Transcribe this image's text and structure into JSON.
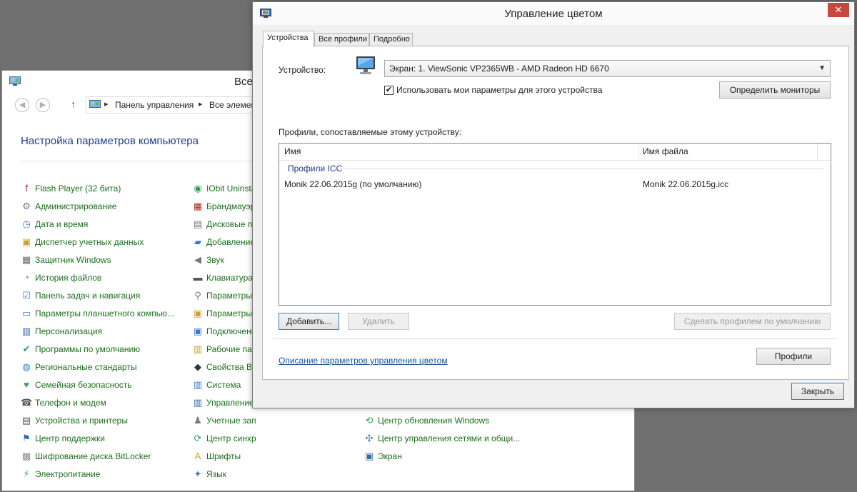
{
  "control_panel": {
    "title": "Все",
    "breadcrumb": [
      "Панель управления",
      "Все элемен"
    ],
    "heading": "Настройка параметров компьютера",
    "col1": [
      {
        "label": "Flash Player (32 бита)",
        "icon": "flash-icon"
      },
      {
        "label": "Администрирование",
        "icon": "admin-tools-icon"
      },
      {
        "label": "Дата и время",
        "icon": "clock-icon"
      },
      {
        "label": "Диспетчер учетных данных",
        "icon": "credential-manager-icon"
      },
      {
        "label": "Защитник Windows",
        "icon": "defender-icon"
      },
      {
        "label": "История файлов",
        "icon": "file-history-icon"
      },
      {
        "label": "Панель задач и навигация",
        "icon": "taskbar-icon"
      },
      {
        "label": "Параметры планшетного компью...",
        "icon": "tablet-icon"
      },
      {
        "label": "Персонализация",
        "icon": "personalization-icon"
      },
      {
        "label": "Программы по умолчанию",
        "icon": "default-programs-icon"
      },
      {
        "label": "Региональные стандарты",
        "icon": "region-icon"
      },
      {
        "label": "Семейная безопасность",
        "icon": "family-safety-icon"
      },
      {
        "label": "Телефон и модем",
        "icon": "phone-modem-icon"
      },
      {
        "label": "Устройства и принтеры",
        "icon": "printer-icon"
      },
      {
        "label": "Центр поддержки",
        "icon": "action-center-flag-icon"
      },
      {
        "label": "Шифрование диска BitLocker",
        "icon": "bitlocker-icon"
      },
      {
        "label": "Электропитание",
        "icon": "power-icon"
      }
    ],
    "col2": [
      {
        "label": "IObit Uninsta",
        "icon": "iobit-icon"
      },
      {
        "label": "Брандмауэр",
        "icon": "firewall-icon"
      },
      {
        "label": "Дисковые п",
        "icon": "storage-spaces-icon"
      },
      {
        "label": "Добавление",
        "icon": "add-features-icon"
      },
      {
        "label": "Звук",
        "icon": "sound-icon"
      },
      {
        "label": "Клавиатура",
        "icon": "keyboard-icon"
      },
      {
        "label": "Параметры",
        "icon": "indexing-icon"
      },
      {
        "label": "Параметры",
        "icon": "folder-options-icon"
      },
      {
        "label": "Подключени",
        "icon": "remoteapp-icon"
      },
      {
        "label": "Рабочие пап",
        "icon": "work-folders-icon"
      },
      {
        "label": "Свойства Ва",
        "icon": "browser-properties-icon"
      },
      {
        "label": "Система",
        "icon": "system-icon"
      },
      {
        "label": "Управление",
        "icon": "color-management-icon"
      },
      {
        "label": "Учетные записи пользователей",
        "icon": "user-accounts-icon"
      },
      {
        "label": "Центр синхронизации",
        "icon": "sync-center-icon"
      },
      {
        "label": "Шрифты",
        "icon": "fonts-icon"
      },
      {
        "label": "Язык",
        "icon": "language-icon"
      }
    ],
    "col3": [
      {
        "label": "Центр обновления Windows",
        "icon": "windows-update-icon"
      },
      {
        "label": "Центр управления сетями и общи...",
        "icon": "network-center-icon"
      },
      {
        "label": "Экран",
        "icon": "display-icon"
      }
    ]
  },
  "dialog": {
    "title": "Управление цветом",
    "close_label": "✕",
    "tabs": [
      "Устройства",
      "Все профили",
      "Подробно"
    ],
    "device_label": "Устройство:",
    "device_value": "Экран: 1. ViewSonic VP2365WB - AMD Radeon HD 6670",
    "use_my_settings_label": "Использовать мои параметры для этого устройства",
    "use_my_settings_checked": true,
    "identify_button": "Определить мониторы",
    "profiles_caption": "Профили, сопоставляемые этому устройству:",
    "columns": [
      "Имя",
      "Имя файла"
    ],
    "group": "Профили ICC",
    "rows": [
      {
        "name": "Monik 22.06.2015g (по умолчанию)",
        "file": "Monik 22.06.2015g.icc"
      }
    ],
    "add_button": "Добавить...",
    "remove_button": "Удалить",
    "set_default_button": "Сделать профилем по умолчанию",
    "link_text": "Описание параметров управления цветом",
    "profiles_button": "Профили",
    "close_button": "Закрыть"
  }
}
